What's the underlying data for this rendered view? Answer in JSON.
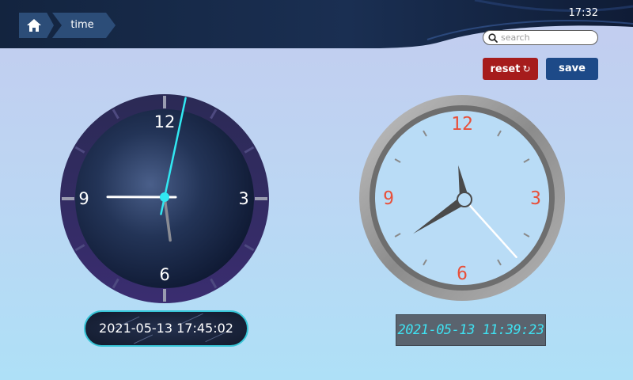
{
  "header": {
    "breadcrumb": {
      "home_icon": "home-icon",
      "current": "time"
    },
    "clock_time": "17:32"
  },
  "search": {
    "placeholder": "search",
    "value": "",
    "icon": "search-icon"
  },
  "actions": {
    "reset_label": "reset",
    "reset_icon": "↻",
    "save_label": "save"
  },
  "colors": {
    "reset": "#a61c1c",
    "save": "#1d4a88",
    "second_hand_left": "#31e8f2",
    "digital_text": "#3fe2f2",
    "right_numerals": "#e8503a"
  },
  "left_clock": {
    "numerals": [
      "12",
      "3",
      "6",
      "9"
    ],
    "time": {
      "hour": 17,
      "minute": 45,
      "second": 2
    },
    "datetime": "2021-05-13 17:45:02"
  },
  "right_clock": {
    "numerals": [
      "12",
      "3",
      "6",
      "9"
    ],
    "time": {
      "hour": 11,
      "minute": 39,
      "second": 23
    },
    "datetime": "2021-05-13 11:39:23"
  }
}
